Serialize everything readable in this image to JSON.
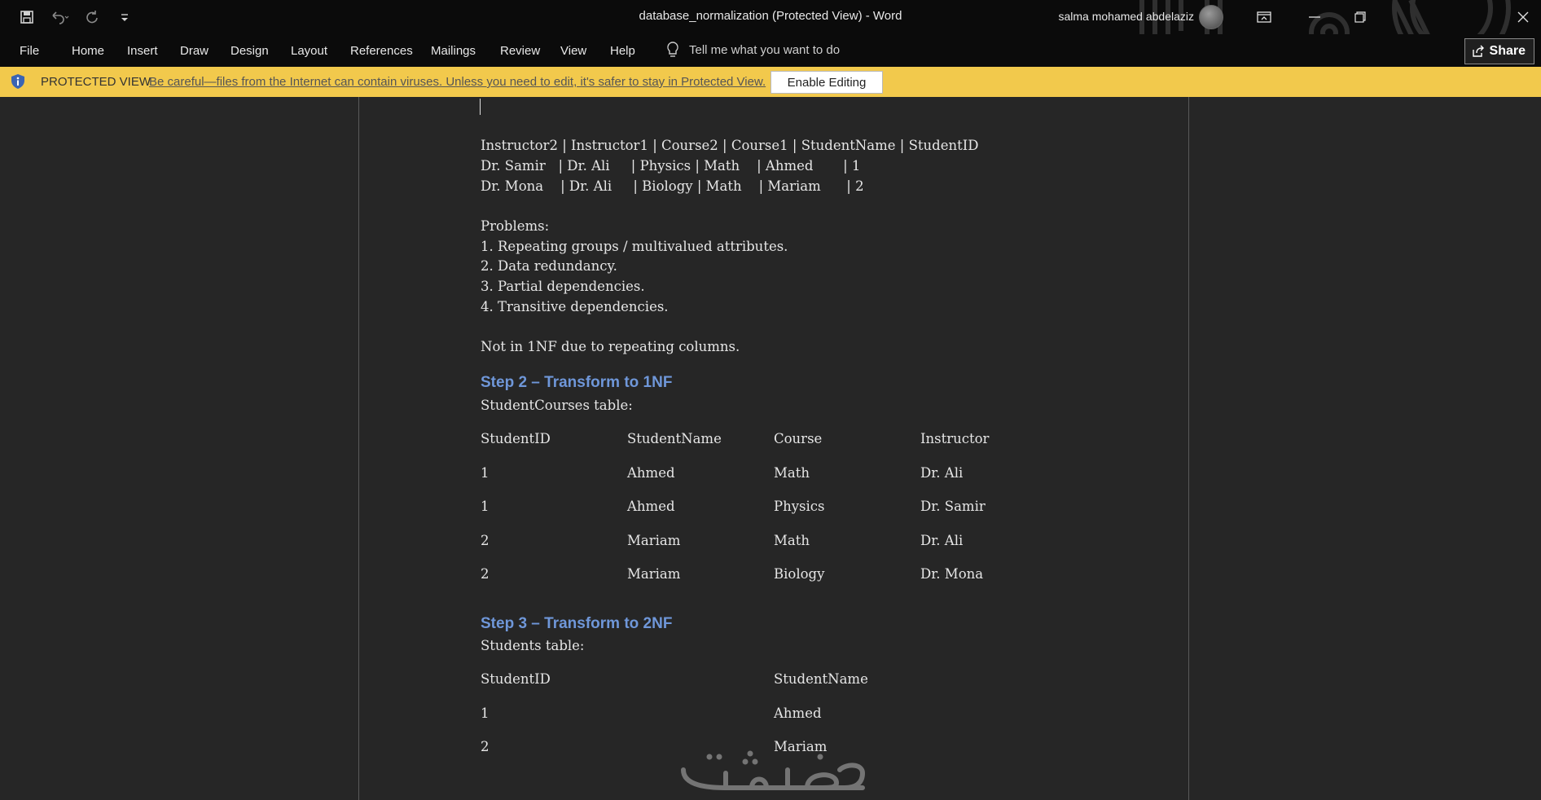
{
  "window": {
    "title": "database_normalization (Protected View)  -  Word",
    "user": "salma mohamed abdelaziz"
  },
  "ribbon": {
    "tabs": [
      "File",
      "Home",
      "Insert",
      "Draw",
      "Design",
      "Layout",
      "References",
      "Mailings",
      "Review",
      "View",
      "Help"
    ],
    "tell_me": "Tell me what you want to do",
    "share": "Share"
  },
  "protected_view": {
    "title": "PROTECTED VIEW",
    "message": "Be careful—files from the Internet can contain viruses. Unless you need to edit, it's safer to stay in Protected View.",
    "button": "Enable Editing"
  },
  "document": {
    "raw_lines": [
      "Instructor2 | Instructor1 | Course2 | Course1 | StudentName | StudentID",
      "Dr. Samir   | Dr. Ali     | Physics | Math    | Ahmed       | 1",
      "Dr. Mona    | Dr. Ali     | Biology | Math    | Mariam      | 2"
    ],
    "problems_title": "Problems:",
    "problems": [
      "1. Repeating groups / multivalued attributes.",
      "2. Data redundancy.",
      "3. Partial dependencies.",
      "4. Transitive dependencies."
    ],
    "not_1nf": "Not in 1NF due to repeating columns.",
    "step2": {
      "heading": "Step 2 – Transform to 1NF",
      "caption": "StudentCourses table:",
      "headers": [
        "StudentID",
        "StudentName",
        "Course",
        "Instructor"
      ],
      "rows": [
        [
          "1",
          "Ahmed",
          "Math",
          "Dr. Ali"
        ],
        [
          "1",
          "Ahmed",
          "Physics",
          "Dr. Samir"
        ],
        [
          "2",
          "Mariam",
          "Math",
          "Dr. Ali"
        ],
        [
          "2",
          "Mariam",
          "Biology",
          "Dr. Mona"
        ]
      ]
    },
    "step3": {
      "heading": "Step 3 – Transform to 2NF",
      "caption": "Students table:",
      "headers": [
        "StudentID",
        "StudentName"
      ],
      "rows": [
        [
          "1",
          "Ahmed"
        ],
        [
          "2",
          "Mariam"
        ]
      ]
    }
  },
  "watermark": "خمسات"
}
